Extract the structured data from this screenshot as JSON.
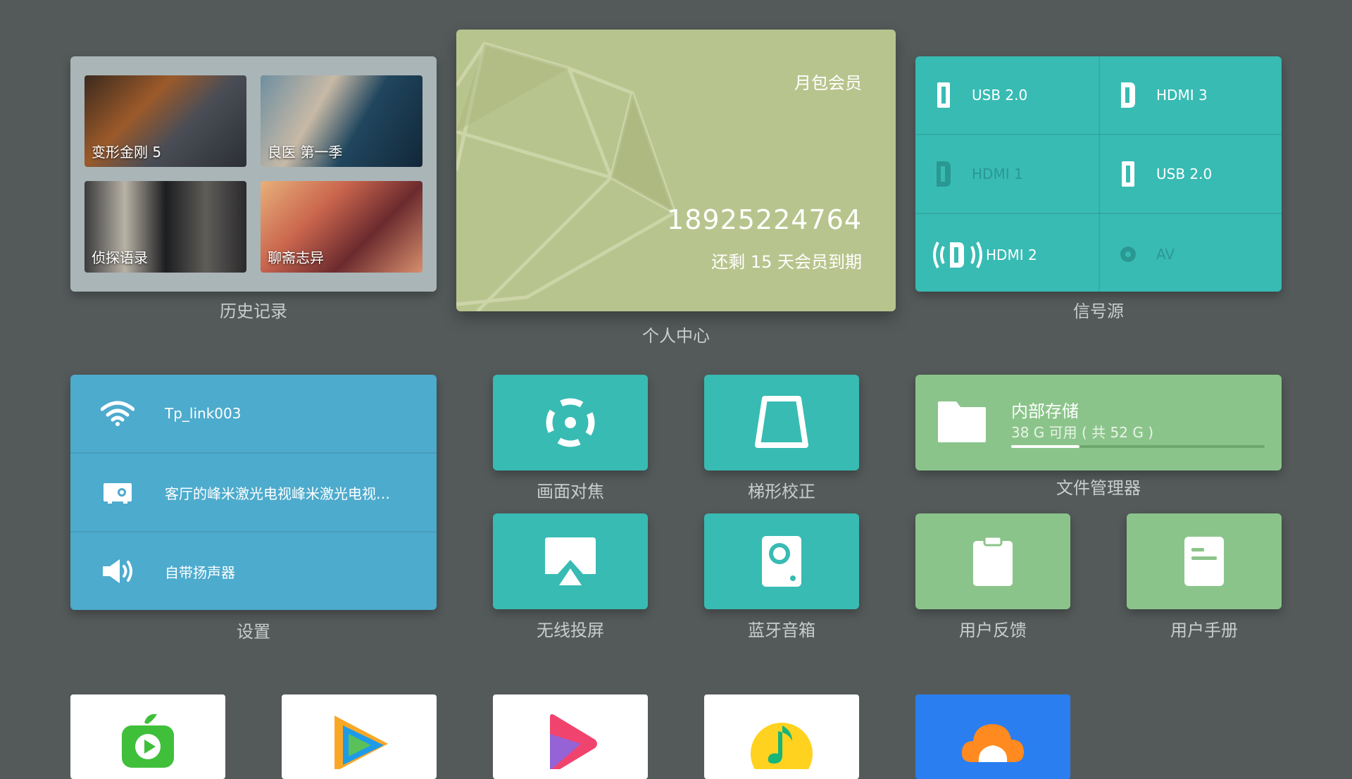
{
  "history": {
    "caption": "历史记录",
    "items": [
      {
        "title": "变形金刚 5"
      },
      {
        "title": "良医 第一季"
      },
      {
        "title": "侦探语录"
      },
      {
        "title": "聊斋志异"
      }
    ]
  },
  "member": {
    "caption": "个人中心",
    "type": "月包会员",
    "phone": "18925224764",
    "expiry": "还剩 15 天会员到期"
  },
  "signal": {
    "caption": "信号源",
    "sources": [
      {
        "label": "USB 2.0",
        "icon": "usb-icon",
        "active": true
      },
      {
        "label": "HDMI 3",
        "icon": "hdmi-icon",
        "active": true
      },
      {
        "label": "HDMI 1",
        "icon": "hdmi-icon",
        "active": false
      },
      {
        "label": "USB 2.0",
        "icon": "usb-icon",
        "active": true
      },
      {
        "label": "HDMI 2",
        "icon": "hdmi-signal-icon",
        "active": true
      },
      {
        "label": "AV",
        "icon": "av-icon",
        "active": false
      }
    ]
  },
  "settings": {
    "caption": "设置",
    "wifi": "Tp_link003",
    "projector": "客厅的峰米激光电视峰米激光电视…",
    "speaker": "自带扬声器"
  },
  "tools": {
    "focus": "画面对焦",
    "keystone": "梯形校正",
    "cast": "无线投屏",
    "bluetooth": "蓝牙音箱",
    "feedback": "用户反馈",
    "manual": "用户手册"
  },
  "files": {
    "caption": "文件管理器",
    "title": "内部存储",
    "usage": "38 G 可用 ( 共 52 G )",
    "used_fraction": 0.27
  },
  "apps": [
    {
      "icon": "iqiyi-icon"
    },
    {
      "icon": "tencent-video-icon"
    },
    {
      "icon": "video-play-icon"
    },
    {
      "icon": "music-icon"
    },
    {
      "icon": "cloud-app-icon"
    }
  ],
  "colors": {
    "background": "#545a5a",
    "teal": "#38bbb3",
    "green": "#8bc48a",
    "blue": "#4dabcd",
    "member": "#b8c48d"
  }
}
